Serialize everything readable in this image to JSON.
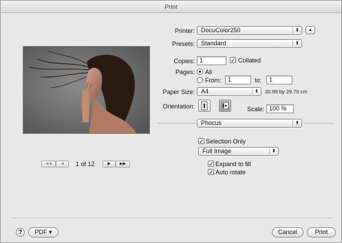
{
  "window": {
    "title": "Print"
  },
  "printer": {
    "label": "Printer:",
    "value": "DocuColor250"
  },
  "presets": {
    "label": "Presets:",
    "value": "Standard"
  },
  "copies": {
    "label": "Copies:",
    "value": "1",
    "collated_label": "Collated",
    "collated_checked": true
  },
  "pages": {
    "label": "Pages:",
    "all_label": "All",
    "from_label": "From:",
    "from_value": "1",
    "to_label": "to:",
    "to_value": "1",
    "selected": "All"
  },
  "paper_size": {
    "label": "Paper Size:",
    "value": "A4",
    "dimensions": "20.99 by 29.70 cm"
  },
  "orientation": {
    "label": "Orientation:",
    "selected": "landscape"
  },
  "scale": {
    "label": "Scale:",
    "value": "100 %"
  },
  "panel": {
    "value": "Phocus"
  },
  "options": {
    "selection_only_label": "Selection Only",
    "selection_only_checked": true,
    "image_mode": "Full Image",
    "expand_label": "Expand to fill",
    "expand_checked": true,
    "auto_rotate_label": "Auto rotate",
    "auto_rotate_checked": true
  },
  "preview": {
    "page_indicator": "1 of 12",
    "first_icon": "◀◀",
    "prev_icon": "◀",
    "next_icon": "▶",
    "last_icon": "▶▶"
  },
  "footer": {
    "help_icon": "?",
    "pdf_label": "PDF ▾",
    "cancel_label": "Cancel",
    "print_label": "Print"
  },
  "icons": {
    "popup_arrows": "⬍",
    "disclosure": "▲",
    "checkmark": "✓"
  }
}
